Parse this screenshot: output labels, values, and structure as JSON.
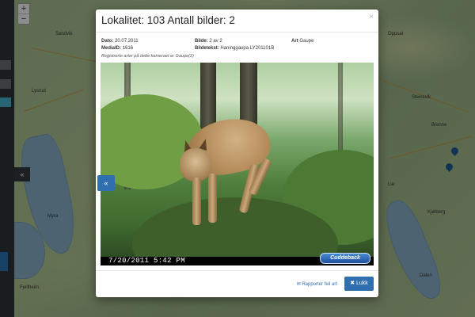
{
  "map": {
    "zoom_in": "+",
    "zoom_out": "−",
    "place_names": [
      "Lysrud",
      "Sandvik",
      "Oppsal",
      "Steinsvik",
      "Brenne",
      "Lia",
      "Kjølberg",
      "Myra",
      "Fjellheim",
      "Dalen"
    ]
  },
  "sidebar": {
    "collapse_icon": "«"
  },
  "modal": {
    "title": "Lokalitet: 103 Antall bilder: 2",
    "close_icon": "×",
    "meta": {
      "date_label": "Dato:",
      "date_value": "20.07.2011",
      "media_label": "MediaID:",
      "media_value": "1616",
      "image_label": "Bilde:",
      "image_value": "2 av 2",
      "image_text_label": "Bildetekst:",
      "image_text_value": "Haninggaupa LY201101B",
      "species_label": "Art",
      "species_value": "Gaupe"
    },
    "registered_text": "Registrerte arter på dette kameraet er Gaupe(2)",
    "photo": {
      "timestamp": "7/20/2011  5:42 PM",
      "brand": "Cuddeback"
    },
    "prev_icon": "«",
    "footer": {
      "report_label": "Rapporter feil art",
      "close_label": "Lukk"
    }
  },
  "colors": {
    "primary": "#2f6fb0",
    "sidebar": "#2f3539",
    "overlay": "rgba(0,0,0,0.45)"
  }
}
